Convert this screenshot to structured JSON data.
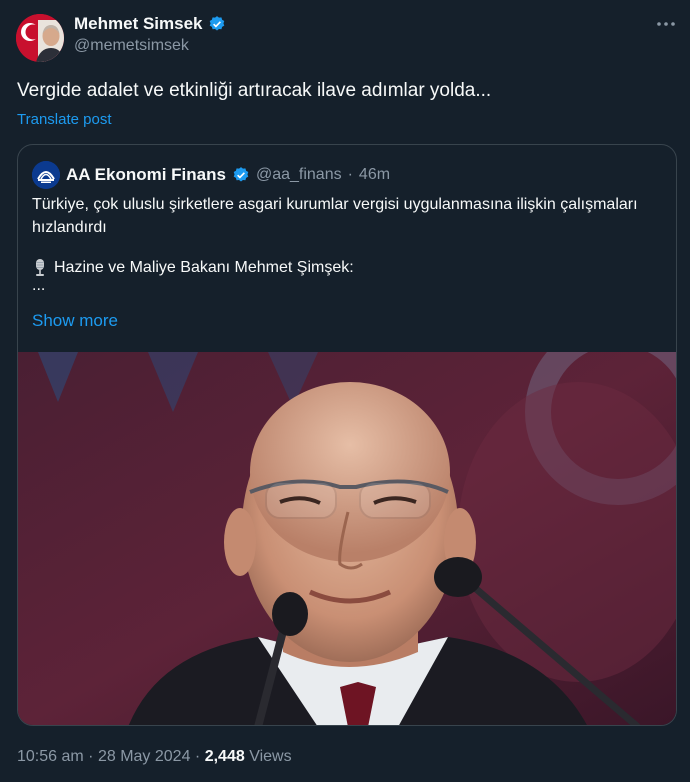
{
  "author": {
    "name": "Mehmet Simsek",
    "handle": "@memetsimsek"
  },
  "tweet": {
    "text": "Vergide adalet ve etkinliği artıracak ilave adımlar yolda...",
    "translate_label": "Translate post"
  },
  "quote": {
    "name": "AA Ekonomi Finans",
    "handle": "@aa_finans",
    "separator": "·",
    "time": "46m",
    "text": "Türkiye, çok uluslu şirketlere asgari kurumlar vergisi uygulanmasına ilişkin çalışmaları hızlandırdı",
    "line2": "Hazine ve Maliye Bakanı Mehmet Şimşek:",
    "ellipsis": "...",
    "show_more": "Show more"
  },
  "footer": {
    "time": "10:56 am",
    "separator1": "·",
    "date": "28 May 2024",
    "separator2": "·",
    "views_count": "2,448",
    "views_label": "Views"
  },
  "icons": {
    "verified": "verified-badge-icon",
    "more": "more-options-icon",
    "microphone": "studio-microphone-icon"
  },
  "colors": {
    "background": "#15202b",
    "link": "#1d9bf0",
    "secondary_text": "#8b98a5",
    "border": "#38444d"
  }
}
